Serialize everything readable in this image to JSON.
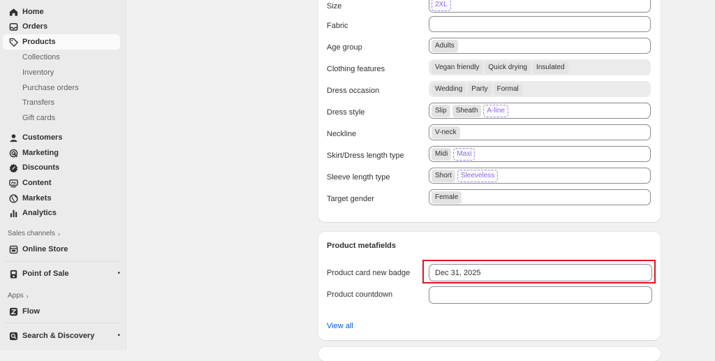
{
  "sidebar": {
    "nav": [
      {
        "label": "Home",
        "icon": "home-icon"
      },
      {
        "label": "Orders",
        "icon": "inbox-icon"
      },
      {
        "label": "Products",
        "icon": "tag-icon"
      }
    ],
    "product_sub": [
      "Collections",
      "Inventory",
      "Purchase orders",
      "Transfers",
      "Gift cards"
    ],
    "nav2": [
      {
        "label": "Customers",
        "icon": "person-icon"
      },
      {
        "label": "Marketing",
        "icon": "target-icon"
      },
      {
        "label": "Discounts",
        "icon": "discount-icon"
      },
      {
        "label": "Content",
        "icon": "content-icon"
      },
      {
        "label": "Markets",
        "icon": "globe-icon"
      },
      {
        "label": "Analytics",
        "icon": "chart-icon"
      }
    ],
    "sales_channels_label": "Sales channels",
    "online_store": "Online Store",
    "point_of_sale": "Point of Sale",
    "apps_label": "Apps",
    "flow": "Flow",
    "search_discovery": "Search & Discovery",
    "dot": "•",
    "chevron": "›"
  },
  "attributes": [
    {
      "label": "Size",
      "tags": [
        {
          "text": "2XL",
          "pending": true
        }
      ],
      "readonly": false
    },
    {
      "label": "Fabric",
      "tags": [],
      "readonly": false
    },
    {
      "label": "Age group",
      "tags": [
        {
          "text": "Adults"
        }
      ],
      "readonly": false
    },
    {
      "label": "Clothing features",
      "tags": [
        {
          "text": "Vegan friendly"
        },
        {
          "text": "Quick drying"
        },
        {
          "text": "Insulated"
        }
      ],
      "readonly": true
    },
    {
      "label": "Dress occasion",
      "tags": [
        {
          "text": "Wedding"
        },
        {
          "text": "Party"
        },
        {
          "text": "Formal"
        }
      ],
      "readonly": true
    },
    {
      "label": "Dress style",
      "tags": [
        {
          "text": "Slip"
        },
        {
          "text": "Sheath"
        },
        {
          "text": "A-line",
          "pending": true
        }
      ],
      "readonly": false
    },
    {
      "label": "Neckline",
      "tags": [
        {
          "text": "V-neck"
        }
      ],
      "readonly": false
    },
    {
      "label": "Skirt/Dress length type",
      "tags": [
        {
          "text": "Midi"
        },
        {
          "text": "Maxi",
          "pending": true
        }
      ],
      "readonly": false
    },
    {
      "label": "Sleeve length type",
      "tags": [
        {
          "text": "Short"
        },
        {
          "text": "Sleeveless",
          "pending": true
        }
      ],
      "readonly": false
    },
    {
      "label": "Target gender",
      "tags": [
        {
          "text": "Female"
        }
      ],
      "readonly": false
    }
  ],
  "metafields": {
    "title": "Product metafields",
    "card_badge_label": "Product card new badge",
    "card_badge_value": "Dec 31, 2025",
    "countdown_label": "Product countdown",
    "countdown_value": "",
    "view_all": "View all"
  },
  "colors": {
    "highlight": "#e0141e",
    "link": "#005bd3",
    "pending_tag": "#8c68f0"
  }
}
